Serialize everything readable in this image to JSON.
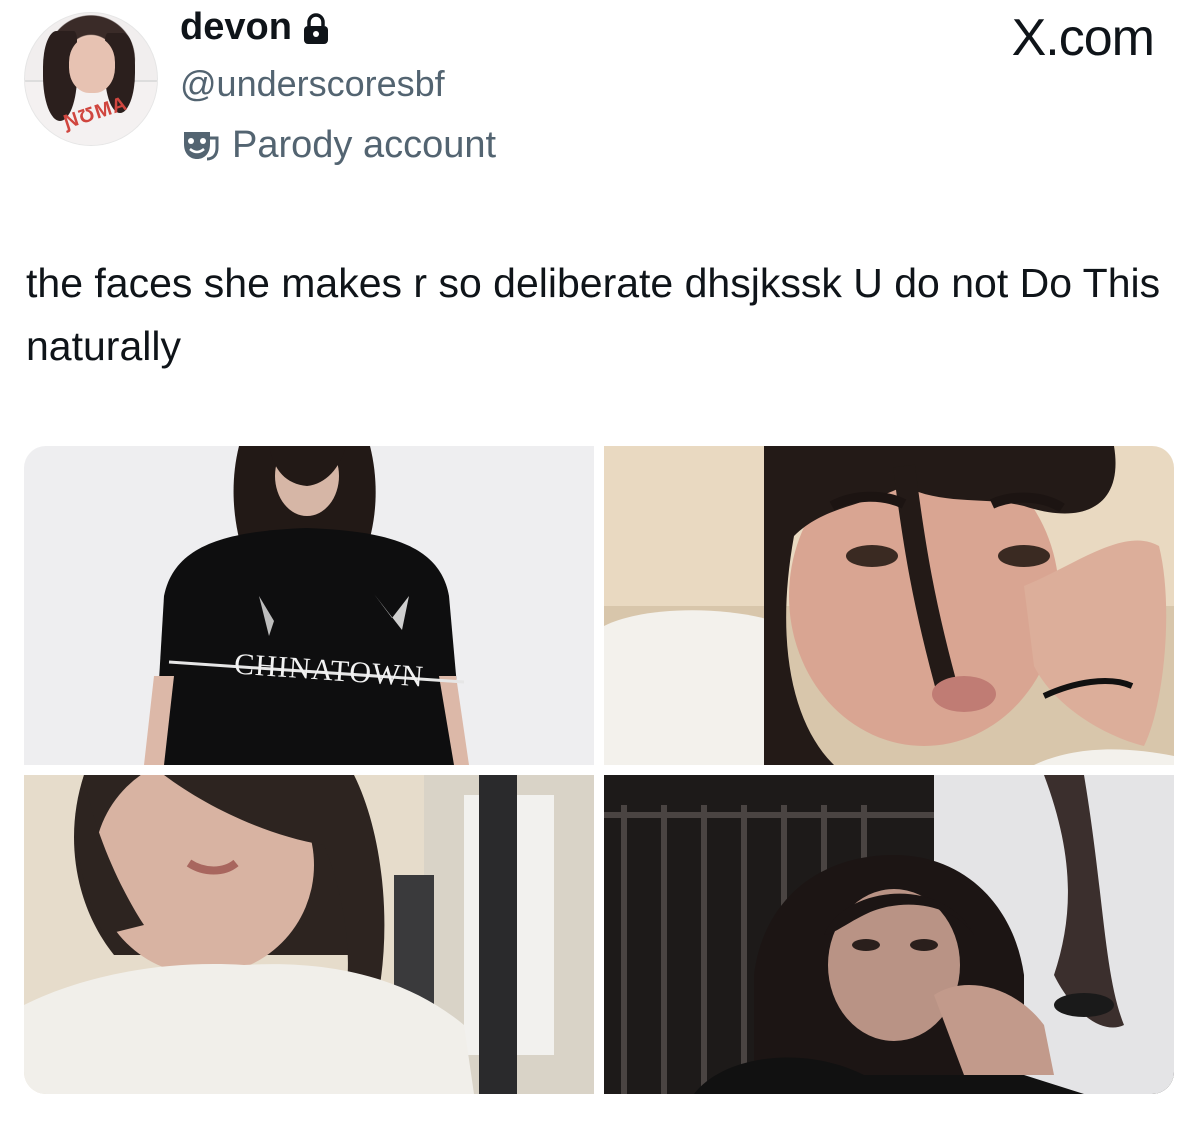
{
  "author": {
    "display_name": "devon",
    "handle": "@underscoresbf",
    "label": "Parody account",
    "locked_icon": "lock-icon",
    "label_icon": "theater-mask-icon"
  },
  "brand": "X.com",
  "tweet": {
    "text": "the faces she makes r so deliberate dhsjkssk  U do not Do This naturally"
  },
  "media": {
    "count": 4,
    "shirt_text": "CHINATOWN"
  },
  "colors": {
    "text": "#0f1419",
    "secondary": "#536471"
  }
}
